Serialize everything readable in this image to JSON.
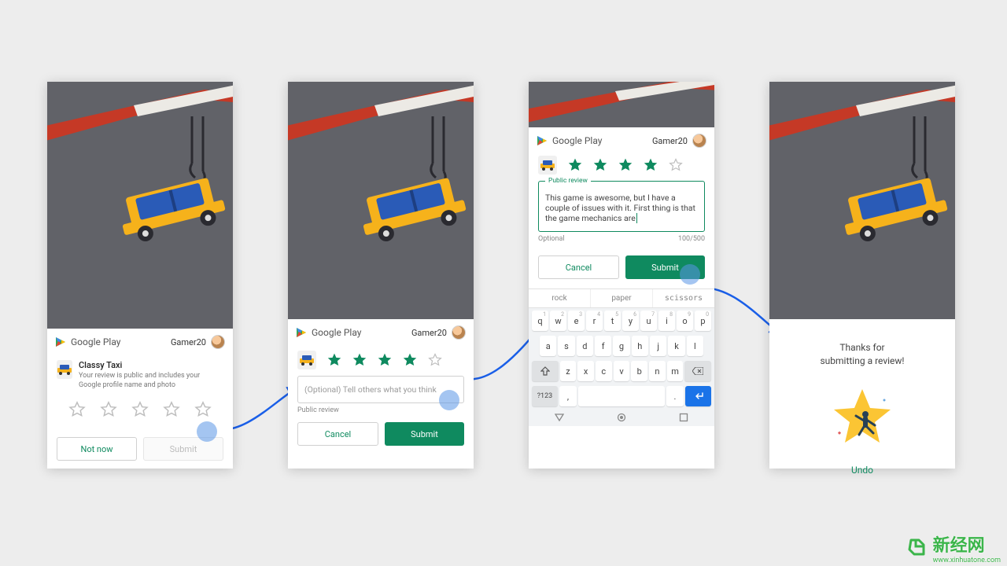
{
  "google_play_label": "Google Play",
  "user": {
    "name": "Gamer20"
  },
  "screen1": {
    "app_name": "Classy Taxi",
    "app_desc": "Your review is public and includes your Google profile name and photo",
    "not_now": "Not now",
    "submit": "Submit",
    "rating": 0
  },
  "screen2": {
    "rating": 4,
    "placeholder": "(Optional) Tell others what you think",
    "helper": "Public review",
    "cancel": "Cancel",
    "submit": "Submit"
  },
  "screen3": {
    "rating": 4,
    "float_label": "Public review",
    "review_text": "This game is awesome, but I have a couple of issues with it. First thing is that the game mechanics are",
    "optional": "Optional",
    "char_count": "100/500",
    "cancel": "Cancel",
    "submit": "Submit",
    "suggestions": [
      "rock",
      "paper",
      "scissors"
    ],
    "keyboard_rows": {
      "row1": [
        {
          "k": "q",
          "n": "1"
        },
        {
          "k": "w",
          "n": "2"
        },
        {
          "k": "e",
          "n": "3"
        },
        {
          "k": "r",
          "n": "4"
        },
        {
          "k": "t",
          "n": "5"
        },
        {
          "k": "y",
          "n": "6"
        },
        {
          "k": "u",
          "n": "7"
        },
        {
          "k": "i",
          "n": "8"
        },
        {
          "k": "o",
          "n": "9"
        },
        {
          "k": "p",
          "n": "0"
        }
      ],
      "row2": [
        "a",
        "s",
        "d",
        "f",
        "g",
        "h",
        "j",
        "k",
        "l"
      ],
      "row3": [
        "z",
        "x",
        "c",
        "v",
        "b",
        "n",
        "m"
      ],
      "row4_sym": "?123",
      "row4_comma": ",",
      "row4_dot": "."
    }
  },
  "screen4": {
    "thanks_l1": "Thanks for",
    "thanks_l2": "submitting a review!",
    "undo": "Undo"
  },
  "watermark": {
    "text": "新经网",
    "url": "www.xinhuatone.com"
  },
  "colors": {
    "accent": "#0f8a5f",
    "blue": "#1a73e8"
  }
}
